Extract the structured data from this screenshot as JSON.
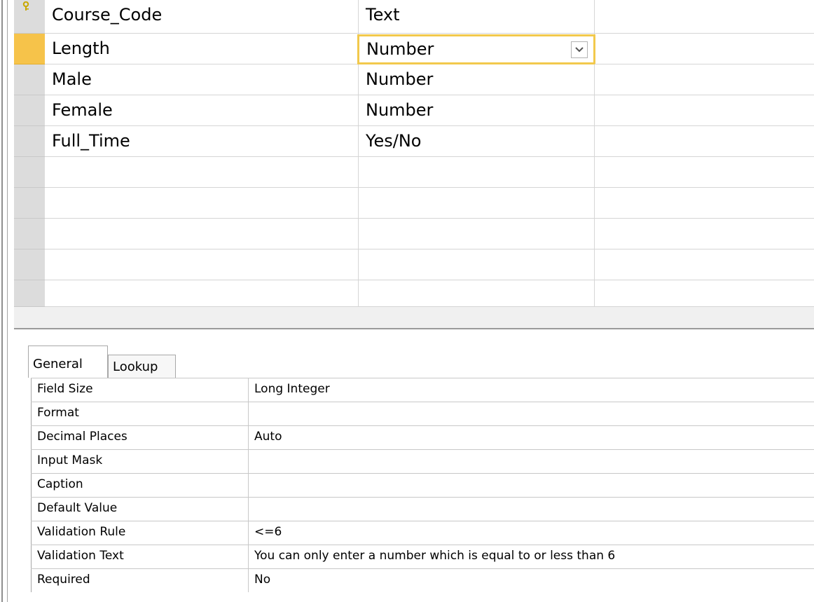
{
  "fields": [
    {
      "name": "Course_Code",
      "type": "Text",
      "primary_key": true
    },
    {
      "name": "Length",
      "type": "Number",
      "current": true
    },
    {
      "name": "Male",
      "type": "Number"
    },
    {
      "name": "Female",
      "type": "Number"
    },
    {
      "name": "Full_Time",
      "type": "Yes/No"
    }
  ],
  "empty_rows": 5,
  "tabs": {
    "general": "General",
    "lookup": "Lookup"
  },
  "properties": [
    {
      "label": "Field Size",
      "value": "Long Integer"
    },
    {
      "label": "Format",
      "value": ""
    },
    {
      "label": "Decimal Places",
      "value": "Auto"
    },
    {
      "label": "Input Mask",
      "value": ""
    },
    {
      "label": "Caption",
      "value": ""
    },
    {
      "label": "Default Value",
      "value": ""
    },
    {
      "label": "Validation Rule",
      "value": "<=6"
    },
    {
      "label": "Validation Text",
      "value": "You can only enter a number which is equal to or less than 6"
    },
    {
      "label": "Required",
      "value": "No"
    }
  ],
  "colors": {
    "current_row": "#f6c34a",
    "active_border": "#f2c94c",
    "key_icon": "#c8a800"
  }
}
